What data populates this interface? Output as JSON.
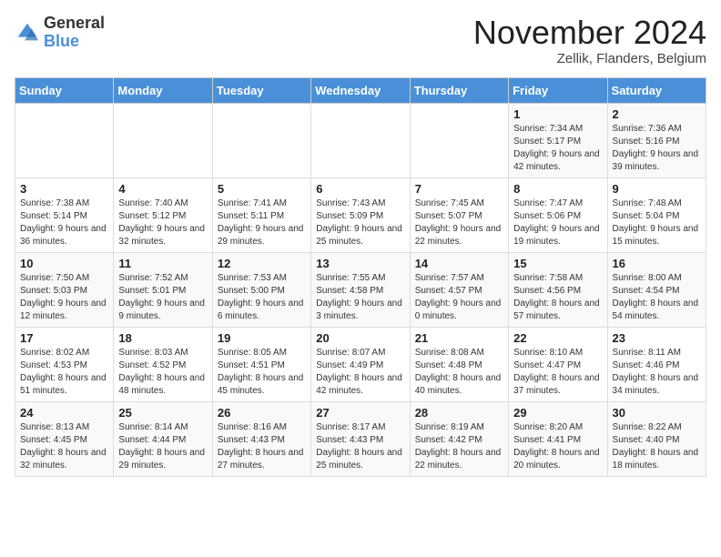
{
  "logo": {
    "general": "General",
    "blue": "Blue"
  },
  "header": {
    "month": "November 2024",
    "location": "Zellik, Flanders, Belgium"
  },
  "weekdays": [
    "Sunday",
    "Monday",
    "Tuesday",
    "Wednesday",
    "Thursday",
    "Friday",
    "Saturday"
  ],
  "weeks": [
    [
      {
        "day": "",
        "info": ""
      },
      {
        "day": "",
        "info": ""
      },
      {
        "day": "",
        "info": ""
      },
      {
        "day": "",
        "info": ""
      },
      {
        "day": "",
        "info": ""
      },
      {
        "day": "1",
        "info": "Sunrise: 7:34 AM\nSunset: 5:17 PM\nDaylight: 9 hours and 42 minutes."
      },
      {
        "day": "2",
        "info": "Sunrise: 7:36 AM\nSunset: 5:16 PM\nDaylight: 9 hours and 39 minutes."
      }
    ],
    [
      {
        "day": "3",
        "info": "Sunrise: 7:38 AM\nSunset: 5:14 PM\nDaylight: 9 hours and 36 minutes."
      },
      {
        "day": "4",
        "info": "Sunrise: 7:40 AM\nSunset: 5:12 PM\nDaylight: 9 hours and 32 minutes."
      },
      {
        "day": "5",
        "info": "Sunrise: 7:41 AM\nSunset: 5:11 PM\nDaylight: 9 hours and 29 minutes."
      },
      {
        "day": "6",
        "info": "Sunrise: 7:43 AM\nSunset: 5:09 PM\nDaylight: 9 hours and 25 minutes."
      },
      {
        "day": "7",
        "info": "Sunrise: 7:45 AM\nSunset: 5:07 PM\nDaylight: 9 hours and 22 minutes."
      },
      {
        "day": "8",
        "info": "Sunrise: 7:47 AM\nSunset: 5:06 PM\nDaylight: 9 hours and 19 minutes."
      },
      {
        "day": "9",
        "info": "Sunrise: 7:48 AM\nSunset: 5:04 PM\nDaylight: 9 hours and 15 minutes."
      }
    ],
    [
      {
        "day": "10",
        "info": "Sunrise: 7:50 AM\nSunset: 5:03 PM\nDaylight: 9 hours and 12 minutes."
      },
      {
        "day": "11",
        "info": "Sunrise: 7:52 AM\nSunset: 5:01 PM\nDaylight: 9 hours and 9 minutes."
      },
      {
        "day": "12",
        "info": "Sunrise: 7:53 AM\nSunset: 5:00 PM\nDaylight: 9 hours and 6 minutes."
      },
      {
        "day": "13",
        "info": "Sunrise: 7:55 AM\nSunset: 4:58 PM\nDaylight: 9 hours and 3 minutes."
      },
      {
        "day": "14",
        "info": "Sunrise: 7:57 AM\nSunset: 4:57 PM\nDaylight: 9 hours and 0 minutes."
      },
      {
        "day": "15",
        "info": "Sunrise: 7:58 AM\nSunset: 4:56 PM\nDaylight: 8 hours and 57 minutes."
      },
      {
        "day": "16",
        "info": "Sunrise: 8:00 AM\nSunset: 4:54 PM\nDaylight: 8 hours and 54 minutes."
      }
    ],
    [
      {
        "day": "17",
        "info": "Sunrise: 8:02 AM\nSunset: 4:53 PM\nDaylight: 8 hours and 51 minutes."
      },
      {
        "day": "18",
        "info": "Sunrise: 8:03 AM\nSunset: 4:52 PM\nDaylight: 8 hours and 48 minutes."
      },
      {
        "day": "19",
        "info": "Sunrise: 8:05 AM\nSunset: 4:51 PM\nDaylight: 8 hours and 45 minutes."
      },
      {
        "day": "20",
        "info": "Sunrise: 8:07 AM\nSunset: 4:49 PM\nDaylight: 8 hours and 42 minutes."
      },
      {
        "day": "21",
        "info": "Sunrise: 8:08 AM\nSunset: 4:48 PM\nDaylight: 8 hours and 40 minutes."
      },
      {
        "day": "22",
        "info": "Sunrise: 8:10 AM\nSunset: 4:47 PM\nDaylight: 8 hours and 37 minutes."
      },
      {
        "day": "23",
        "info": "Sunrise: 8:11 AM\nSunset: 4:46 PM\nDaylight: 8 hours and 34 minutes."
      }
    ],
    [
      {
        "day": "24",
        "info": "Sunrise: 8:13 AM\nSunset: 4:45 PM\nDaylight: 8 hours and 32 minutes."
      },
      {
        "day": "25",
        "info": "Sunrise: 8:14 AM\nSunset: 4:44 PM\nDaylight: 8 hours and 29 minutes."
      },
      {
        "day": "26",
        "info": "Sunrise: 8:16 AM\nSunset: 4:43 PM\nDaylight: 8 hours and 27 minutes."
      },
      {
        "day": "27",
        "info": "Sunrise: 8:17 AM\nSunset: 4:43 PM\nDaylight: 8 hours and 25 minutes."
      },
      {
        "day": "28",
        "info": "Sunrise: 8:19 AM\nSunset: 4:42 PM\nDaylight: 8 hours and 22 minutes."
      },
      {
        "day": "29",
        "info": "Sunrise: 8:20 AM\nSunset: 4:41 PM\nDaylight: 8 hours and 20 minutes."
      },
      {
        "day": "30",
        "info": "Sunrise: 8:22 AM\nSunset: 4:40 PM\nDaylight: 8 hours and 18 minutes."
      }
    ]
  ]
}
